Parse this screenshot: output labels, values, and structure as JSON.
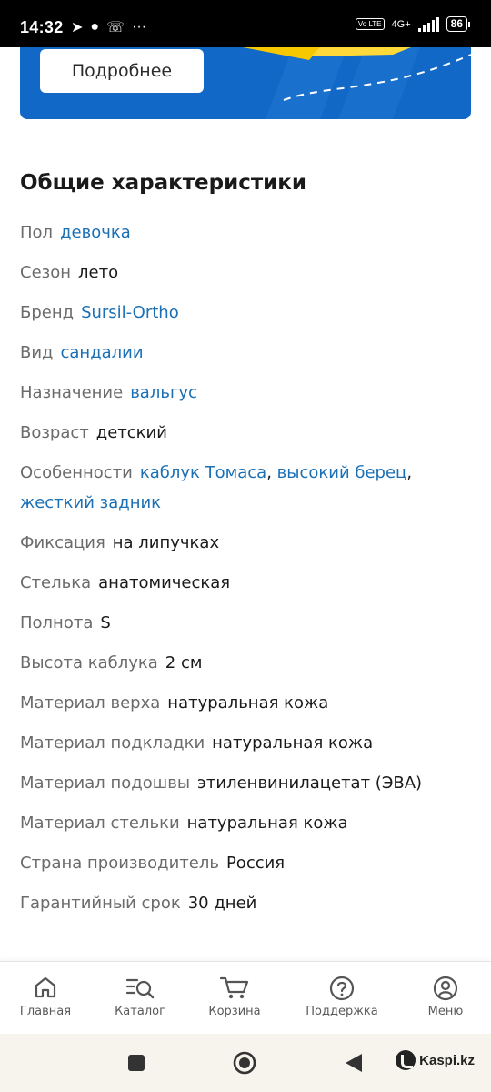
{
  "status_bar": {
    "time": "14:32",
    "network": "4G+",
    "volte": "Vo LTE",
    "battery": "86"
  },
  "banner": {
    "button_label": "Подробнее",
    "background_color": "#1268c6",
    "accent_color": "#f7c800"
  },
  "section": {
    "title": "Общие характеристики"
  },
  "specs": [
    {
      "label": "Пол",
      "value": "девочка",
      "link": true
    },
    {
      "label": "Сезон",
      "value": "лето",
      "link": false
    },
    {
      "label": "Бренд",
      "value": "Sursil-Ortho",
      "link": true
    },
    {
      "label": "Вид",
      "value": "сандалии",
      "link": true
    },
    {
      "label": "Назначение",
      "value": "вальгус",
      "link": true
    },
    {
      "label": "Возраст",
      "value": "детский",
      "link": false
    },
    {
      "label": "Особенности",
      "values": [
        "каблук Томаса",
        "высокий берец",
        "жесткий задник"
      ],
      "link": true
    },
    {
      "label": "Фиксация",
      "value": "на липучках",
      "link": false
    },
    {
      "label": "Стелька",
      "value": "анатомическая",
      "link": false
    },
    {
      "label": "Полнота",
      "value": "S",
      "link": false
    },
    {
      "label": "Высота каблука",
      "value": "2 см",
      "link": false
    },
    {
      "label": "Материал верха",
      "value": "натуральная кожа",
      "link": false
    },
    {
      "label": "Материал подкладки",
      "value": "натуральная кожа",
      "link": false
    },
    {
      "label": "Материал подошвы",
      "value": "этиленвинилацетат (ЭВА)",
      "link": false
    },
    {
      "label": "Материал стельки",
      "value": "натуральная кожа",
      "link": false
    },
    {
      "label": "Страна производитель",
      "value": "Россия",
      "link": false
    },
    {
      "label": "Гарантийный срок",
      "value": "30 дней",
      "link": false
    }
  ],
  "bottom_nav": [
    {
      "label": "Главная",
      "icon": "home-icon"
    },
    {
      "label": "Каталог",
      "icon": "catalog-search-icon"
    },
    {
      "label": "Корзина",
      "icon": "cart-icon"
    },
    {
      "label": "Поддержка",
      "icon": "help-icon"
    },
    {
      "label": "Меню",
      "icon": "profile-icon"
    }
  ],
  "system_nav": {
    "brand": "Kaspi.kz"
  },
  "colors": {
    "link": "#1a6fb5",
    "label": "#6b6b6b"
  }
}
